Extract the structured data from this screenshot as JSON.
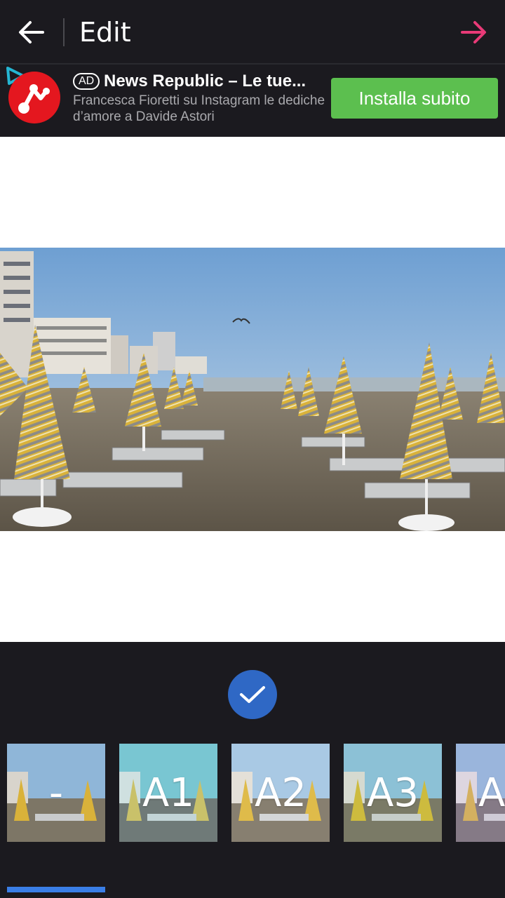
{
  "header": {
    "title": "Edit"
  },
  "ad": {
    "badge": "AD",
    "title": "News Republic – Le tue...",
    "body": "Francesca Fioretti su Instagram le dediche d’amore a Davide Astori",
    "cta": "Installa subito"
  },
  "filters": [
    {
      "label": "-"
    },
    {
      "label": "A1"
    },
    {
      "label": "A2"
    },
    {
      "label": "A3"
    },
    {
      "label": "A"
    }
  ],
  "colors": {
    "background": "#1b1a1f",
    "accent_next": "#e83a77",
    "cta_green": "#5cbf4f",
    "confirm_blue": "#2f68c5",
    "selection_blue": "#3a7ee6"
  },
  "icons": [
    "back-arrow-icon",
    "forward-arrow-icon",
    "adchoices-icon",
    "news-republic-logo",
    "checkmark-icon"
  ]
}
